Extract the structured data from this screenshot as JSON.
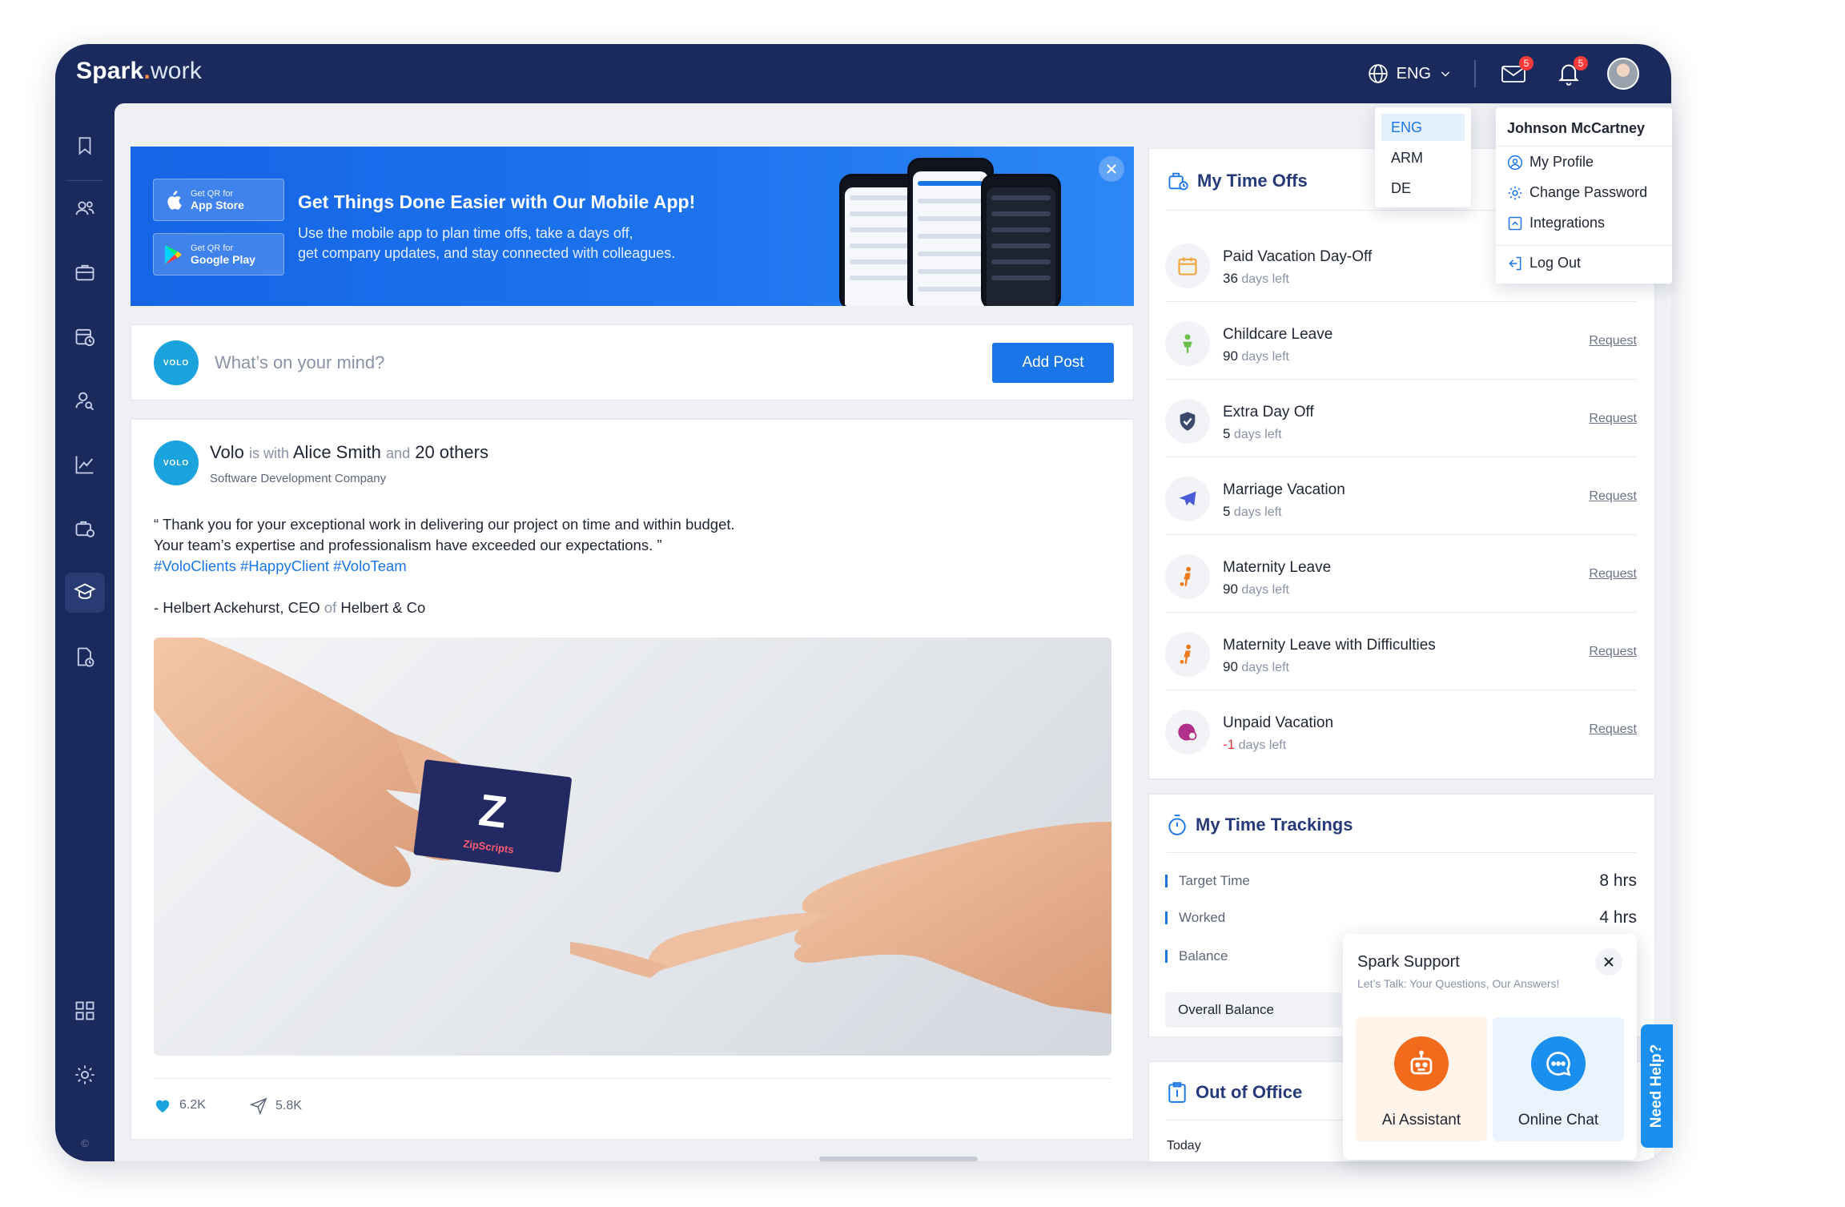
{
  "app": {
    "logo_main": "Spark",
    "logo_dot": ".",
    "logo_suffix": "work"
  },
  "topbar": {
    "language": "ENG",
    "mail_badge": "5",
    "notifications_badge": "5"
  },
  "language_menu": {
    "options": [
      "ENG",
      "ARM",
      "DE"
    ],
    "selected": "ENG"
  },
  "user_menu": {
    "name": "Johnson McCartney",
    "items": [
      "My Profile",
      "Change Password",
      "Integrations",
      "Log Out"
    ]
  },
  "banner": {
    "app_store_small": "Get QR for",
    "app_store_big": "App Store",
    "google_small": "Get QR for",
    "google_big": "Google Play",
    "title": "Get Things Done Easier with Our Mobile App!",
    "desc_line1": "Use the mobile app to plan time offs, take a days off,",
    "desc_line2": "get company updates, and stay connected with colleagues."
  },
  "composer": {
    "logo_text": "VOLO",
    "placeholder": "What’s on your mind?",
    "button": "Add Post"
  },
  "post": {
    "author": "Volo",
    "is_with": "is with",
    "tagged": "Alice Smith",
    "and": "and",
    "others": "20 others",
    "company": "Software Development Company",
    "line1": "“ Thank you for your exceptional work in delivering our project on time and within budget.",
    "line2": "Your team’s expertise and professionalism have exceeded our expectations. ”",
    "tags": "#VoloClients #HappyClient #VoloTeam",
    "sign_name": "- Helbert Ackehurst, CEO",
    "sign_of": "of",
    "sign_company": "Helbert & Co",
    "card_brand": "ZipScripts",
    "likes": "6.2K",
    "shares": "5.8K"
  },
  "time_offs": {
    "title": "My Time Offs",
    "days_left": "days left",
    "request": "Request",
    "items": [
      {
        "name": "Paid Vacation Day-Off",
        "days": "36",
        "icon": "calendar-icon",
        "color": "#f2a33a"
      },
      {
        "name": "Childcare Leave",
        "days": "90",
        "icon": "child-icon",
        "color": "#6cc04a"
      },
      {
        "name": "Extra Day Off",
        "days": "5",
        "icon": "shield-icon",
        "color": "#3b4a6b"
      },
      {
        "name": "Marriage Vacation",
        "days": "5",
        "icon": "plane-icon",
        "color": "#4a5bd8"
      },
      {
        "name": "Maternity Leave",
        "days": "90",
        "icon": "stroller-icon",
        "color": "#f07a1a"
      },
      {
        "name": "Maternity Leave with Difficulties",
        "days": "90",
        "icon": "stroller-icon",
        "color": "#f07a1a"
      },
      {
        "name": "Unpaid Vacation",
        "days": "-1",
        "icon": "unpaid-icon",
        "color": "#b0308a"
      }
    ]
  },
  "time_trackings": {
    "title": "My Time Trackings",
    "rows": [
      {
        "label": "Target Time",
        "value": "8 hrs"
      },
      {
        "label": "Worked",
        "value": "4 hrs"
      },
      {
        "label": "Balance",
        "value": ""
      }
    ],
    "overall": "Overall Balance"
  },
  "out_of_office": {
    "title": "Out of Office",
    "today": "Today"
  },
  "support": {
    "title": "Spark Support",
    "subtitle": "Let’s Talk: Your Questions, Our Answers!",
    "ai": "Ai Assistant",
    "chat": "Online Chat",
    "need_help": "Need Help?"
  },
  "footer": {
    "copyright": "©"
  }
}
